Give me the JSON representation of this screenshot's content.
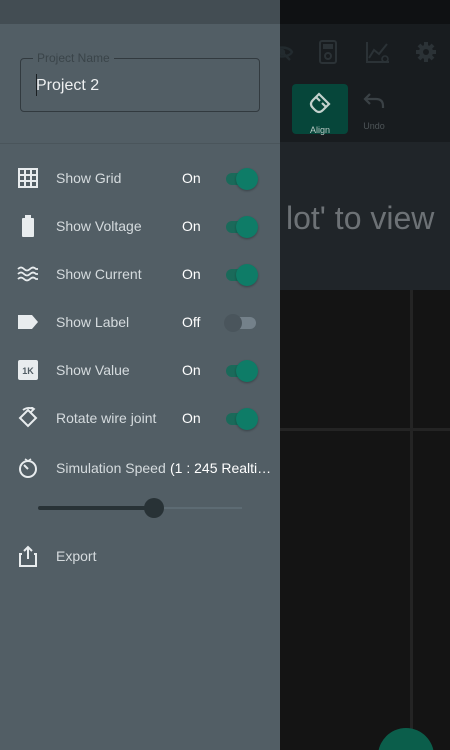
{
  "background": {
    "message_partial": "lot' to view",
    "tools": [
      {
        "label": "Align",
        "icon": "magnet-icon",
        "state": "active"
      },
      {
        "label": "Undo",
        "icon": "undo-icon",
        "state": "disabled"
      }
    ],
    "top_icons": [
      "eye-off-icon",
      "calculator-icon",
      "graph-icon",
      "gear-icon"
    ]
  },
  "drawer": {
    "project": {
      "label": "Project Name",
      "value": "Project 2"
    },
    "settings": [
      {
        "id": "show-grid",
        "label": "Show Grid",
        "state": "On",
        "on": true,
        "icon": "grid-icon"
      },
      {
        "id": "show-voltage",
        "label": "Show Voltage",
        "state": "On",
        "on": true,
        "icon": "battery-icon"
      },
      {
        "id": "show-current",
        "label": "Show Current",
        "state": "On",
        "on": true,
        "icon": "waves-icon"
      },
      {
        "id": "show-label",
        "label": "Show Label",
        "state": "Off",
        "on": false,
        "icon": "label-icon"
      },
      {
        "id": "show-value",
        "label": "Show Value",
        "state": "On",
        "on": true,
        "icon": "one-k-icon",
        "icon_text": "1K"
      },
      {
        "id": "rotate-wire-joint",
        "label": "Rotate wire joint",
        "state": "On",
        "on": true,
        "icon": "rotate-icon"
      }
    ],
    "simulation_speed": {
      "label": "Simulation Speed",
      "value": "(1 : 245 Realtim…",
      "slider_fraction": 0.57,
      "icon": "timer-icon"
    },
    "export": {
      "label": "Export",
      "icon": "share-icon"
    }
  },
  "colors": {
    "accent": "#0e7c67",
    "drawer_bg": "#525e65",
    "app_bg": "#1e1e1e"
  }
}
